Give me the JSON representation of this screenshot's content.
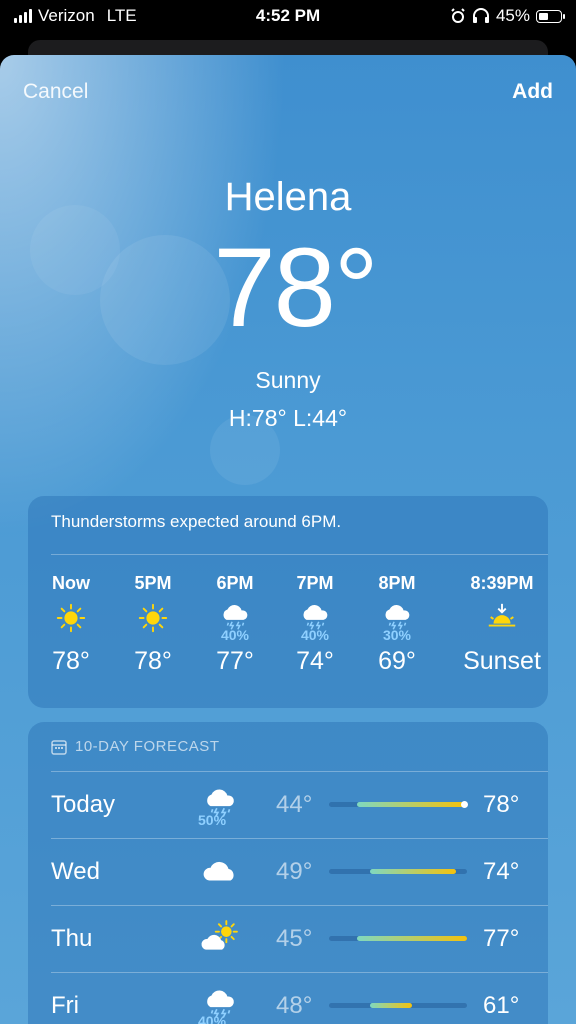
{
  "status_bar": {
    "carrier": "Verizon",
    "network": "LTE",
    "time": "4:52 PM",
    "battery": "45%",
    "battery_level": 0.45
  },
  "nav": {
    "cancel_label": "Cancel",
    "add_label": "Add"
  },
  "current": {
    "city": "Helena",
    "temperature": "78°",
    "condition": "Sunny",
    "high_low": "H:78°  L:44°"
  },
  "hourly": {
    "summary": "Thunderstorms expected around 6PM.",
    "items": [
      {
        "time": "Now",
        "icon": "sun-icon",
        "precip": "",
        "value": "78°"
      },
      {
        "time": "5PM",
        "icon": "sun-icon",
        "precip": "",
        "value": "78°"
      },
      {
        "time": "6PM",
        "icon": "thunderstorm-icon",
        "precip": "40%",
        "value": "77°"
      },
      {
        "time": "7PM",
        "icon": "thunderstorm-icon",
        "precip": "40%",
        "value": "74°"
      },
      {
        "time": "8PM",
        "icon": "thunderstorm-icon",
        "precip": "30%",
        "value": "69°"
      },
      {
        "time": "8:39PM",
        "icon": "sunset-icon",
        "precip": "",
        "value": "Sunset"
      }
    ]
  },
  "ten_day": {
    "header": "10-DAY FORECAST",
    "days": [
      {
        "day": "Today",
        "icon": "thunderstorm-icon",
        "precip": "50%",
        "low": "44°",
        "high": "78°",
        "range_start": 0.2,
        "range_end": 0.98,
        "current_marker": 0.98
      },
      {
        "day": "Wed",
        "icon": "cloud-icon",
        "precip": "",
        "low": "49°",
        "high": "74°",
        "range_start": 0.3,
        "range_end": 0.92
      },
      {
        "day": "Thu",
        "icon": "partly-cloudy-icon",
        "precip": "",
        "low": "45°",
        "high": "77°",
        "range_start": 0.2,
        "range_end": 1.0
      },
      {
        "day": "Fri",
        "icon": "thunderstorm-icon",
        "precip": "40%",
        "low": "48°",
        "high": "61°",
        "range_start": 0.3,
        "range_end": 0.6
      }
    ]
  },
  "colors": {
    "sky_top": "#3f8fcf",
    "sun": "#ffd60a",
    "precip_text": "#8fd0ff",
    "range_cool": "#7fd8c0",
    "range_warm": "#f4c20d"
  }
}
